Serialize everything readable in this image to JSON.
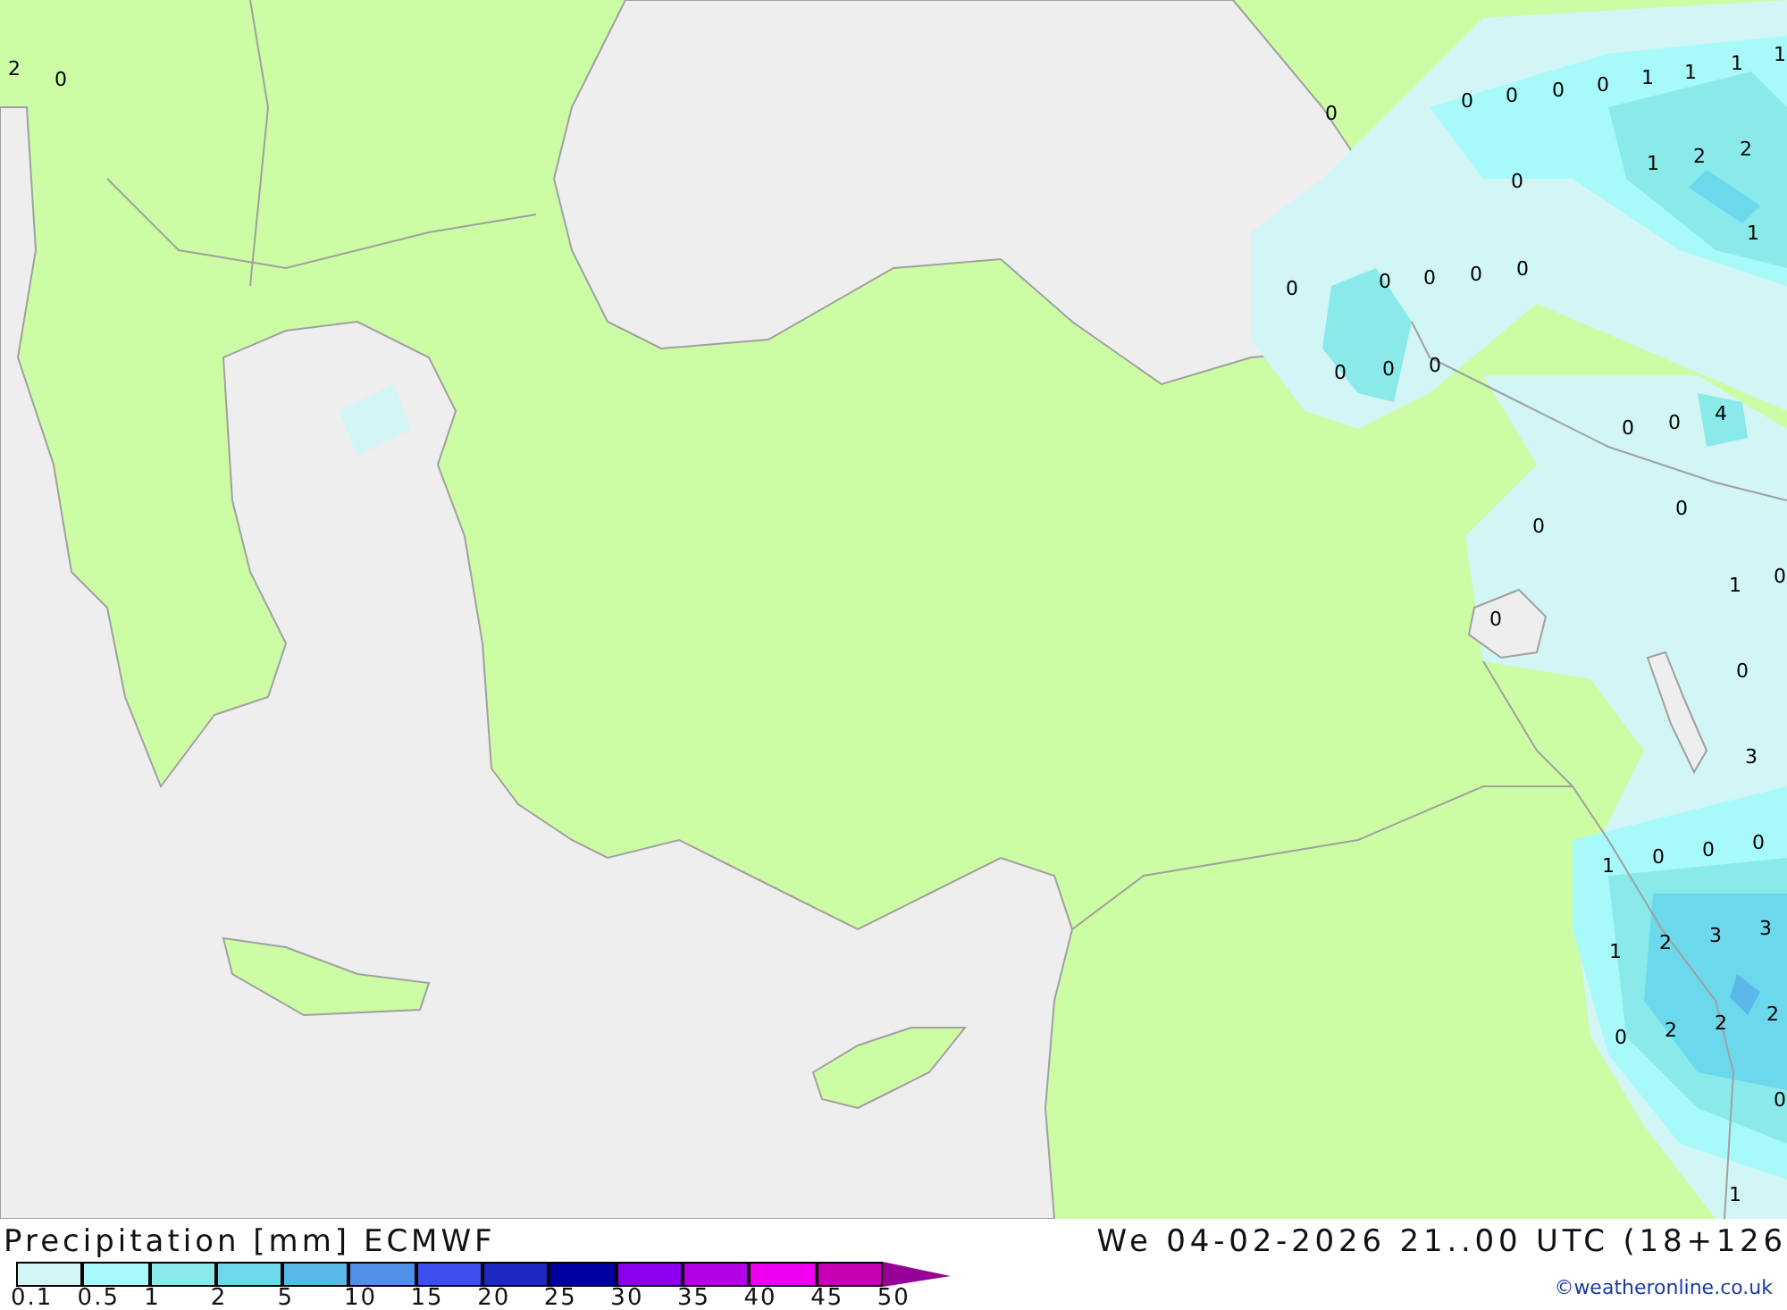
{
  "map": {
    "labels": [
      "2",
      "0",
      "0",
      "0",
      "0",
      "0",
      "0",
      "1",
      "1",
      "1",
      "1",
      "1",
      "2",
      "2",
      "0",
      "1",
      "0",
      "0",
      "0",
      "0",
      "0",
      "0",
      "0",
      "0",
      "0",
      "0",
      "4",
      "0",
      "0",
      "1",
      "0",
      "0",
      "0",
      "3",
      "1",
      "0",
      "0",
      "0",
      "1",
      "2",
      "3",
      "3",
      "0",
      "2",
      "2",
      "2",
      "0",
      "1"
    ]
  },
  "legend": {
    "title": "Precipitation [mm] ECMWF",
    "bins": [
      {
        "label": "0.1",
        "color": "#d2f5f5"
      },
      {
        "label": "0.5",
        "color": "#a8fafa"
      },
      {
        "label": "1",
        "color": "#8aeaea"
      },
      {
        "label": "2",
        "color": "#6cd8ec"
      },
      {
        "label": "5",
        "color": "#5ab8e8"
      },
      {
        "label": "10",
        "color": "#5090e8"
      },
      {
        "label": "15",
        "color": "#3c50f0"
      },
      {
        "label": "20",
        "color": "#1c28c0"
      },
      {
        "label": "25",
        "color": "#0000a0"
      },
      {
        "label": "30",
        "color": "#8c00f0"
      },
      {
        "label": "35",
        "color": "#b400e6"
      },
      {
        "label": "40",
        "color": "#f000f0"
      },
      {
        "label": "45",
        "color": "#c800b4"
      },
      {
        "label": "50",
        "color": "#960096"
      }
    ]
  },
  "timestamp": "We 04-02-2026 21..00 UTC (18+126",
  "credit": "©weatheronline.co.uk"
}
